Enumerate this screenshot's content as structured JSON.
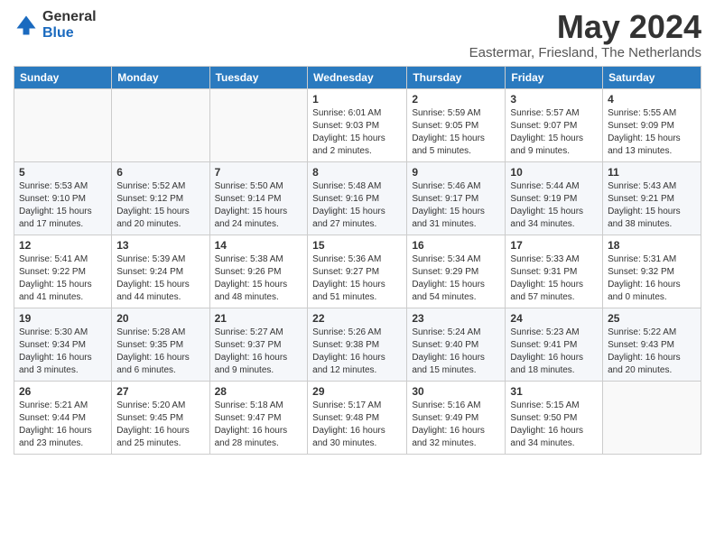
{
  "logo": {
    "general": "General",
    "blue": "Blue"
  },
  "title": {
    "month_year": "May 2024",
    "location": "Eastermar, Friesland, The Netherlands"
  },
  "headers": [
    "Sunday",
    "Monday",
    "Tuesday",
    "Wednesday",
    "Thursday",
    "Friday",
    "Saturday"
  ],
  "weeks": [
    [
      {
        "day": "",
        "info": ""
      },
      {
        "day": "",
        "info": ""
      },
      {
        "day": "",
        "info": ""
      },
      {
        "day": "1",
        "info": "Sunrise: 6:01 AM\nSunset: 9:03 PM\nDaylight: 15 hours\nand 2 minutes."
      },
      {
        "day": "2",
        "info": "Sunrise: 5:59 AM\nSunset: 9:05 PM\nDaylight: 15 hours\nand 5 minutes."
      },
      {
        "day": "3",
        "info": "Sunrise: 5:57 AM\nSunset: 9:07 PM\nDaylight: 15 hours\nand 9 minutes."
      },
      {
        "day": "4",
        "info": "Sunrise: 5:55 AM\nSunset: 9:09 PM\nDaylight: 15 hours\nand 13 minutes."
      }
    ],
    [
      {
        "day": "5",
        "info": "Sunrise: 5:53 AM\nSunset: 9:10 PM\nDaylight: 15 hours\nand 17 minutes."
      },
      {
        "day": "6",
        "info": "Sunrise: 5:52 AM\nSunset: 9:12 PM\nDaylight: 15 hours\nand 20 minutes."
      },
      {
        "day": "7",
        "info": "Sunrise: 5:50 AM\nSunset: 9:14 PM\nDaylight: 15 hours\nand 24 minutes."
      },
      {
        "day": "8",
        "info": "Sunrise: 5:48 AM\nSunset: 9:16 PM\nDaylight: 15 hours\nand 27 minutes."
      },
      {
        "day": "9",
        "info": "Sunrise: 5:46 AM\nSunset: 9:17 PM\nDaylight: 15 hours\nand 31 minutes."
      },
      {
        "day": "10",
        "info": "Sunrise: 5:44 AM\nSunset: 9:19 PM\nDaylight: 15 hours\nand 34 minutes."
      },
      {
        "day": "11",
        "info": "Sunrise: 5:43 AM\nSunset: 9:21 PM\nDaylight: 15 hours\nand 38 minutes."
      }
    ],
    [
      {
        "day": "12",
        "info": "Sunrise: 5:41 AM\nSunset: 9:22 PM\nDaylight: 15 hours\nand 41 minutes."
      },
      {
        "day": "13",
        "info": "Sunrise: 5:39 AM\nSunset: 9:24 PM\nDaylight: 15 hours\nand 44 minutes."
      },
      {
        "day": "14",
        "info": "Sunrise: 5:38 AM\nSunset: 9:26 PM\nDaylight: 15 hours\nand 48 minutes."
      },
      {
        "day": "15",
        "info": "Sunrise: 5:36 AM\nSunset: 9:27 PM\nDaylight: 15 hours\nand 51 minutes."
      },
      {
        "day": "16",
        "info": "Sunrise: 5:34 AM\nSunset: 9:29 PM\nDaylight: 15 hours\nand 54 minutes."
      },
      {
        "day": "17",
        "info": "Sunrise: 5:33 AM\nSunset: 9:31 PM\nDaylight: 15 hours\nand 57 minutes."
      },
      {
        "day": "18",
        "info": "Sunrise: 5:31 AM\nSunset: 9:32 PM\nDaylight: 16 hours\nand 0 minutes."
      }
    ],
    [
      {
        "day": "19",
        "info": "Sunrise: 5:30 AM\nSunset: 9:34 PM\nDaylight: 16 hours\nand 3 minutes."
      },
      {
        "day": "20",
        "info": "Sunrise: 5:28 AM\nSunset: 9:35 PM\nDaylight: 16 hours\nand 6 minutes."
      },
      {
        "day": "21",
        "info": "Sunrise: 5:27 AM\nSunset: 9:37 PM\nDaylight: 16 hours\nand 9 minutes."
      },
      {
        "day": "22",
        "info": "Sunrise: 5:26 AM\nSunset: 9:38 PM\nDaylight: 16 hours\nand 12 minutes."
      },
      {
        "day": "23",
        "info": "Sunrise: 5:24 AM\nSunset: 9:40 PM\nDaylight: 16 hours\nand 15 minutes."
      },
      {
        "day": "24",
        "info": "Sunrise: 5:23 AM\nSunset: 9:41 PM\nDaylight: 16 hours\nand 18 minutes."
      },
      {
        "day": "25",
        "info": "Sunrise: 5:22 AM\nSunset: 9:43 PM\nDaylight: 16 hours\nand 20 minutes."
      }
    ],
    [
      {
        "day": "26",
        "info": "Sunrise: 5:21 AM\nSunset: 9:44 PM\nDaylight: 16 hours\nand 23 minutes."
      },
      {
        "day": "27",
        "info": "Sunrise: 5:20 AM\nSunset: 9:45 PM\nDaylight: 16 hours\nand 25 minutes."
      },
      {
        "day": "28",
        "info": "Sunrise: 5:18 AM\nSunset: 9:47 PM\nDaylight: 16 hours\nand 28 minutes."
      },
      {
        "day": "29",
        "info": "Sunrise: 5:17 AM\nSunset: 9:48 PM\nDaylight: 16 hours\nand 30 minutes."
      },
      {
        "day": "30",
        "info": "Sunrise: 5:16 AM\nSunset: 9:49 PM\nDaylight: 16 hours\nand 32 minutes."
      },
      {
        "day": "31",
        "info": "Sunrise: 5:15 AM\nSunset: 9:50 PM\nDaylight: 16 hours\nand 34 minutes."
      },
      {
        "day": "",
        "info": ""
      }
    ]
  ]
}
